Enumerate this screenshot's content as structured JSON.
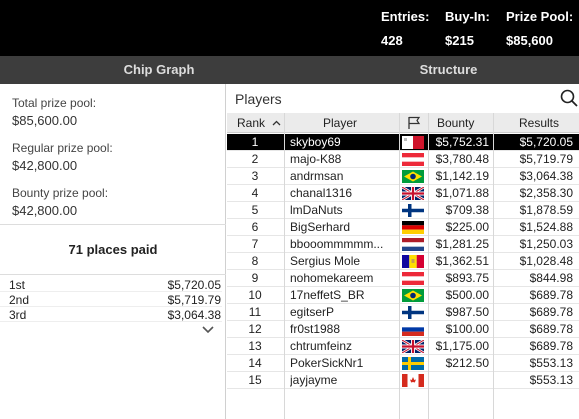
{
  "header": {
    "entries_label": "Entries:",
    "entries_value": "428",
    "buyin_label": "Buy-In:",
    "buyin_value": "$215",
    "prizepool_label": "Prize Pool:",
    "prizepool_value": "$85,600"
  },
  "tabs": [
    {
      "label": "Chip Graph"
    },
    {
      "label": "Structure"
    }
  ],
  "prize_info": {
    "total_label": "Total prize pool:",
    "total_value": "$85,600.00",
    "regular_label": "Regular prize pool:",
    "regular_value": "$42,800.00",
    "bounty_label": "Bounty prize pool:",
    "bounty_value": "$42,800.00"
  },
  "places_paid": "71 places paid",
  "payouts": [
    {
      "place": "1st",
      "amount": "$5,720.05"
    },
    {
      "place": "2nd",
      "amount": "$5,719.79"
    },
    {
      "place": "3rd",
      "amount": "$3,064.38"
    }
  ],
  "players_panel": {
    "title": "Players",
    "columns": {
      "rank": "Rank",
      "player": "Player",
      "bounty": "Bounty",
      "results": "Results"
    }
  },
  "players": [
    {
      "rank": "1",
      "name": "skyboy69",
      "flag": "malta",
      "bounty": "$5,752.31",
      "results": "$5,720.05",
      "selected": true
    },
    {
      "rank": "2",
      "name": "majo-K88",
      "flag": "austria",
      "bounty": "$3,780.48",
      "results": "$5,719.79"
    },
    {
      "rank": "3",
      "name": "andrmsan",
      "flag": "brazil",
      "bounty": "$1,142.19",
      "results": "$3,064.38"
    },
    {
      "rank": "4",
      "name": "chanal1316",
      "flag": "uk",
      "bounty": "$1,071.88",
      "results": "$2,358.30"
    },
    {
      "rank": "5",
      "name": "lmDaNuts",
      "flag": "finland",
      "bounty": "$709.38",
      "results": "$1,878.59"
    },
    {
      "rank": "6",
      "name": "BigSerhard",
      "flag": "germany",
      "bounty": "$225.00",
      "results": "$1,524.88"
    },
    {
      "rank": "7",
      "name": "bbooommmmm...",
      "flag": "netherlands",
      "bounty": "$1,281.25",
      "results": "$1,250.03"
    },
    {
      "rank": "8",
      "name": "Sergius Mole",
      "flag": "andorra",
      "bounty": "$1,362.51",
      "results": "$1,028.48"
    },
    {
      "rank": "9",
      "name": "nohomekareem",
      "flag": "austria",
      "bounty": "$893.75",
      "results": "$844.98"
    },
    {
      "rank": "10",
      "name": "17neffetS_BR",
      "flag": "brazil",
      "bounty": "$500.00",
      "results": "$689.78"
    },
    {
      "rank": "11",
      "name": "egitserP",
      "flag": "finland",
      "bounty": "$987.50",
      "results": "$689.78"
    },
    {
      "rank": "12",
      "name": "fr0st1988",
      "flag": "russia",
      "bounty": "$100.00",
      "results": "$689.78"
    },
    {
      "rank": "13",
      "name": "chtrumfeinz",
      "flag": "uk",
      "bounty": "$1,175.00",
      "results": "$689.78"
    },
    {
      "rank": "14",
      "name": "PokerSickNr1",
      "flag": "sweden",
      "bounty": "$212.50",
      "results": "$553.13"
    },
    {
      "rank": "15",
      "name": "jayjayme",
      "flag": "canada",
      "bounty": "",
      "results": "$553.13"
    }
  ],
  "colors": {
    "topbar": "#000000",
    "tabbar": "#3d3d3d",
    "selected_row": "#000000",
    "header_row": "#ebebeb"
  }
}
